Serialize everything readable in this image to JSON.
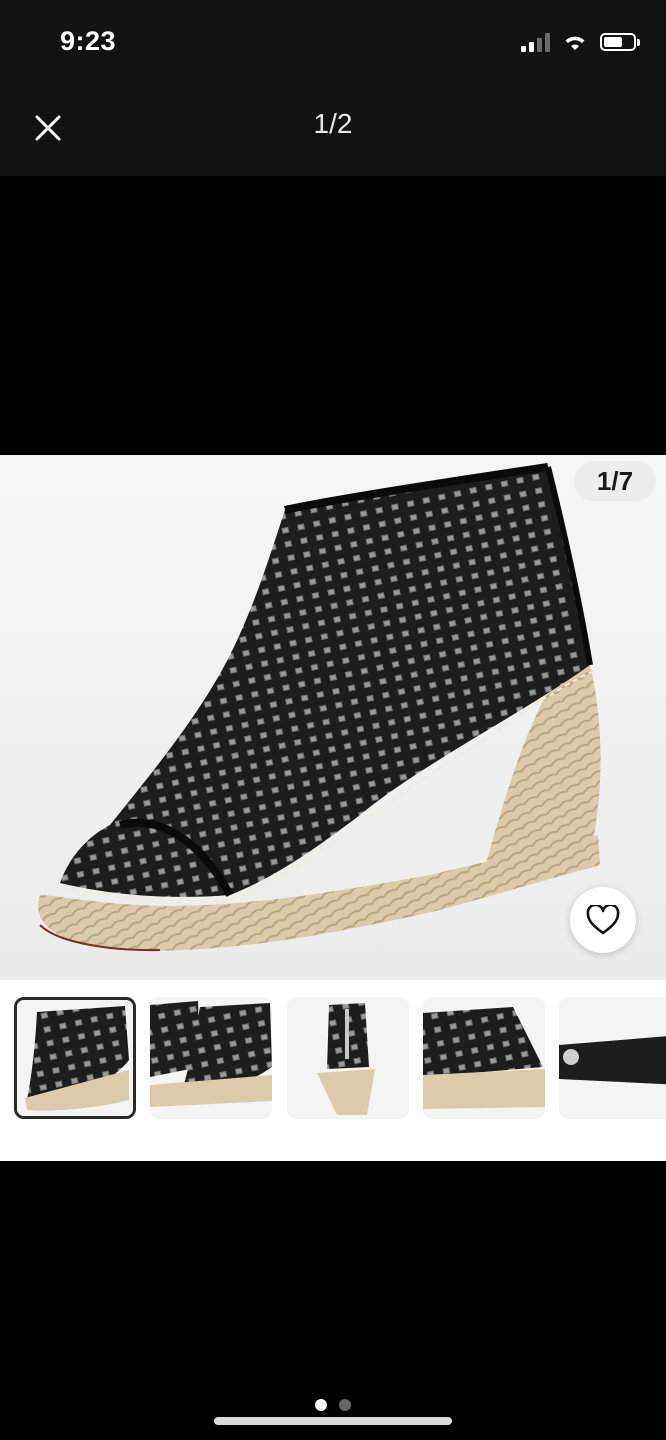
{
  "status_bar": {
    "time": "9:23",
    "icons": [
      "cellular-signal-icon",
      "wifi-icon",
      "battery-icon"
    ]
  },
  "viewer": {
    "close_icon": "close-icon",
    "page_counter": "1/2"
  },
  "product_image": {
    "counter": "1/7",
    "favorite_icon": "heart-icon",
    "thumbnails": [
      {
        "name": "thumbnail-1",
        "selected": true
      },
      {
        "name": "thumbnail-2",
        "selected": false
      },
      {
        "name": "thumbnail-3",
        "selected": false
      },
      {
        "name": "thumbnail-4",
        "selected": false
      },
      {
        "name": "thumbnail-5",
        "selected": false
      }
    ]
  },
  "pager": {
    "total": 2,
    "active": 1
  },
  "colors": {
    "background": "#000000",
    "bar": "#121212",
    "shoe_leather": "#1c1c1c",
    "jute": "#d8c7a6"
  }
}
